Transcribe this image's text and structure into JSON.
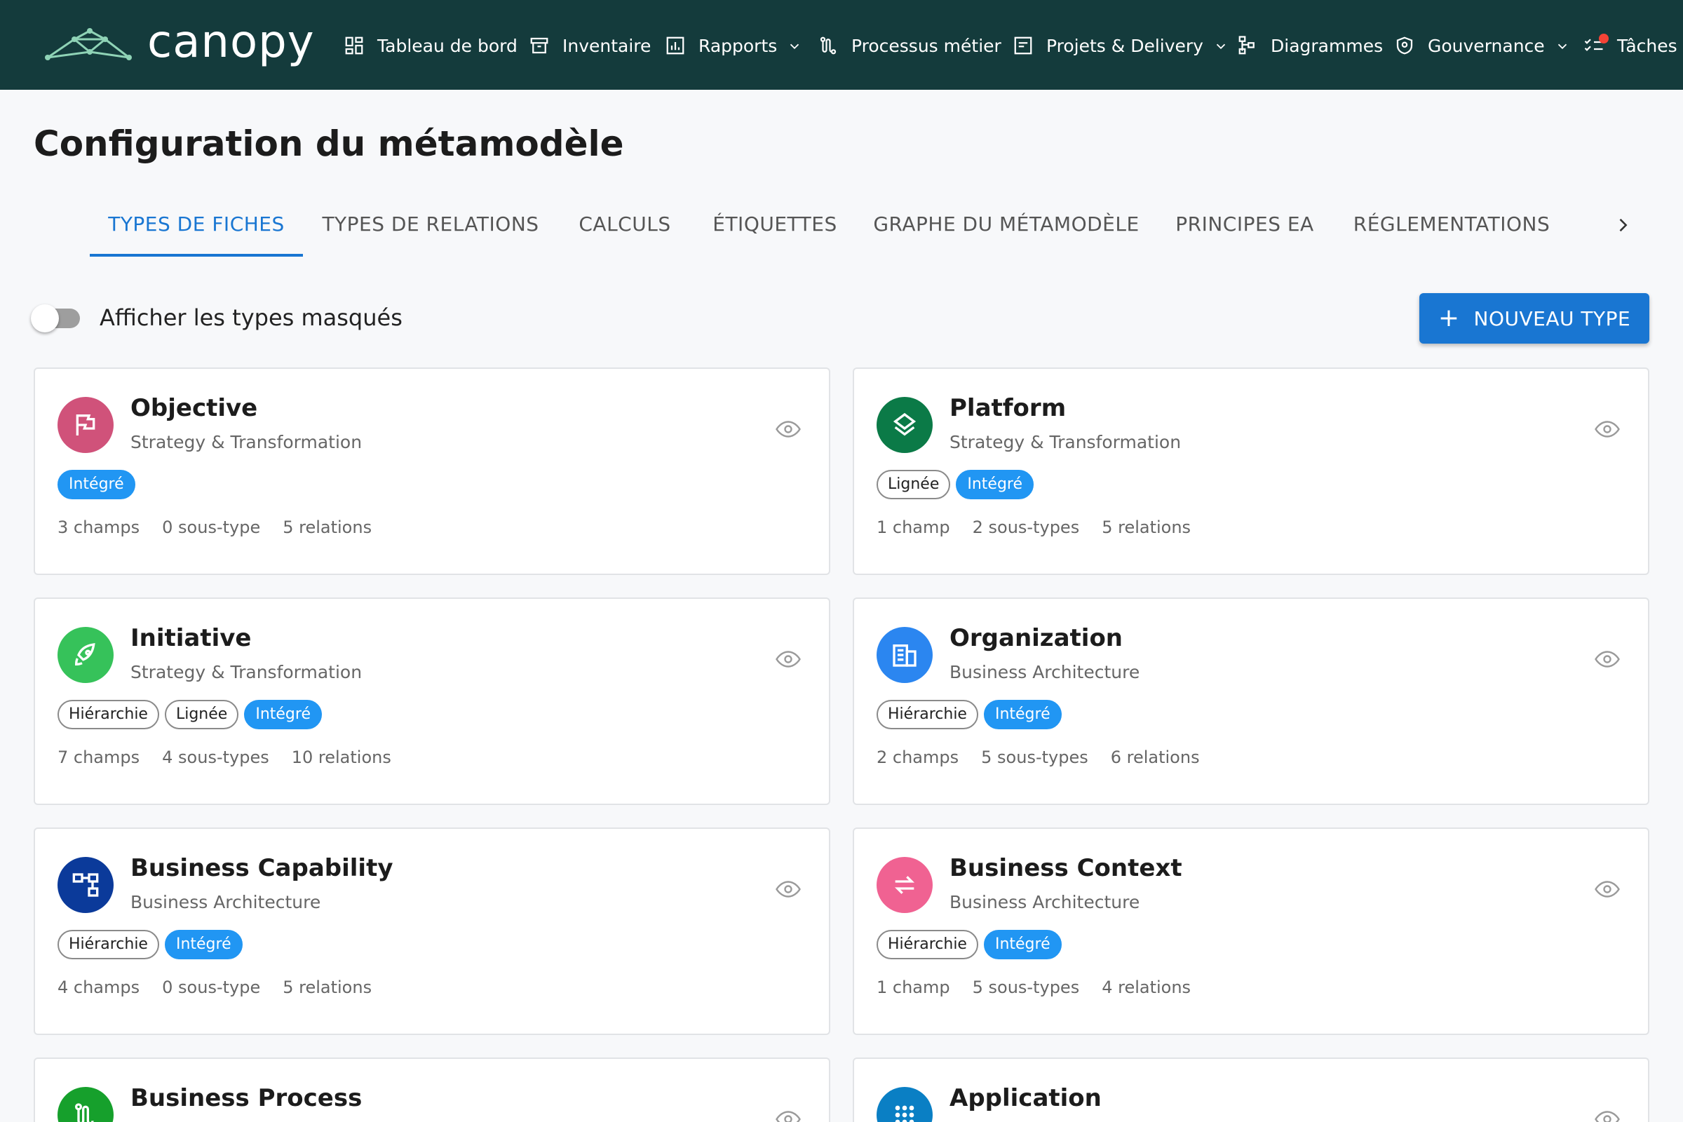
{
  "app": {
    "name": "canopy"
  },
  "nav": {
    "dashboard": "Tableau de bord",
    "inventory": "Inventaire",
    "reports": "Rapports",
    "processes": "Processus métier",
    "projects": "Projets & Delivery",
    "diagrams": "Diagrammes",
    "governance": "Gouvernance",
    "tasks": "Tâches"
  },
  "page": {
    "title": "Configuration du métamodèle"
  },
  "tabs": [
    {
      "label": "TYPES DE FICHES",
      "active": true
    },
    {
      "label": "TYPES DE RELATIONS"
    },
    {
      "label": "CALCULS"
    },
    {
      "label": "ÉTIQUETTES"
    },
    {
      "label": "GRAPHE DU MÉTAMODÈLE"
    },
    {
      "label": "PRINCIPES EA"
    },
    {
      "label": "RÉGLEMENTATIONS"
    }
  ],
  "toolbar": {
    "toggle_label": "Afficher les types masqués",
    "toggle_on": false,
    "new_button": "NOUVEAU TYPE"
  },
  "colors": {
    "topbar": "#143b3c",
    "primary": "#1976d2",
    "chip_filled": "#2196f3"
  },
  "cards": [
    {
      "name": "Objective",
      "category": "Strategy & Transformation",
      "icon": "flag-icon",
      "color": "#d0527a",
      "chips": [
        {
          "label": "Intégré",
          "filled": true
        }
      ],
      "stats": {
        "fields": "3 champs",
        "subtypes": "0 sous-type",
        "relations": "5 relations"
      }
    },
    {
      "name": "Platform",
      "category": "Strategy & Transformation",
      "icon": "layers-icon",
      "color": "#0b7a47",
      "chips": [
        {
          "label": "Lignée",
          "filled": false
        },
        {
          "label": "Intégré",
          "filled": true
        }
      ],
      "stats": {
        "fields": "1 champ",
        "subtypes": "2 sous-types",
        "relations": "5 relations"
      }
    },
    {
      "name": "Initiative",
      "category": "Strategy & Transformation",
      "icon": "rocket-icon",
      "color": "#36c25a",
      "chips": [
        {
          "label": "Hiérarchie",
          "filled": false
        },
        {
          "label": "Lignée",
          "filled": false
        },
        {
          "label": "Intégré",
          "filled": true
        }
      ],
      "stats": {
        "fields": "7 champs",
        "subtypes": "4 sous-types",
        "relations": "10 relations"
      }
    },
    {
      "name": "Organization",
      "category": "Business Architecture",
      "icon": "building-icon",
      "color": "#2b86f0",
      "chips": [
        {
          "label": "Hiérarchie",
          "filled": false
        },
        {
          "label": "Intégré",
          "filled": true
        }
      ],
      "stats": {
        "fields": "2 champs",
        "subtypes": "5 sous-types",
        "relations": "6 relations"
      }
    },
    {
      "name": "Business Capability",
      "category": "Business Architecture",
      "icon": "hierarchy-icon",
      "color": "#0b3a9a",
      "chips": [
        {
          "label": "Hiérarchie",
          "filled": false
        },
        {
          "label": "Intégré",
          "filled": true
        }
      ],
      "stats": {
        "fields": "4 champs",
        "subtypes": "0 sous-type",
        "relations": "5 relations"
      }
    },
    {
      "name": "Business Context",
      "category": "Business Architecture",
      "icon": "swap-icon",
      "color": "#f06292",
      "chips": [
        {
          "label": "Hiérarchie",
          "filled": false
        },
        {
          "label": "Intégré",
          "filled": true
        }
      ],
      "stats": {
        "fields": "1 champ",
        "subtypes": "5 sous-types",
        "relations": "4 relations"
      }
    },
    {
      "name": "Business Process",
      "category": "",
      "icon": "process-icon",
      "color": "#16a02c",
      "chips": [],
      "stats": {}
    },
    {
      "name": "Application",
      "category": "",
      "icon": "apps-icon",
      "color": "#0a7fc4",
      "chips": [],
      "stats": {}
    }
  ]
}
